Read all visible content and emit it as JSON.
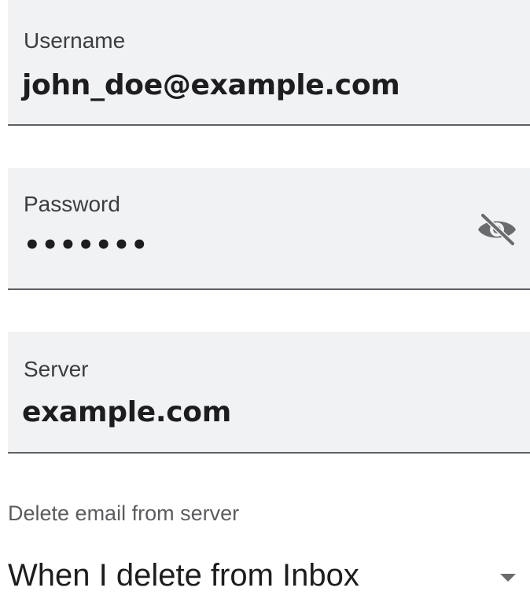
{
  "username": {
    "label": "Username",
    "value": "john_doe@example.com"
  },
  "password": {
    "label": "Password",
    "masked_value": "•••••••",
    "toggle_icon": "eye-off-icon"
  },
  "server": {
    "label": "Server",
    "value": "example.com"
  },
  "delete_policy": {
    "label": "Delete email from server",
    "selected": "When I delete from Inbox",
    "arrow_icon": "dropdown-arrow-icon"
  },
  "colors": {
    "field_background": "#f1f2f4",
    "underline": "#5f6063",
    "text": "#1d1d1f",
    "label_text": "#3c3d40",
    "icon": "#6a6b6e"
  }
}
